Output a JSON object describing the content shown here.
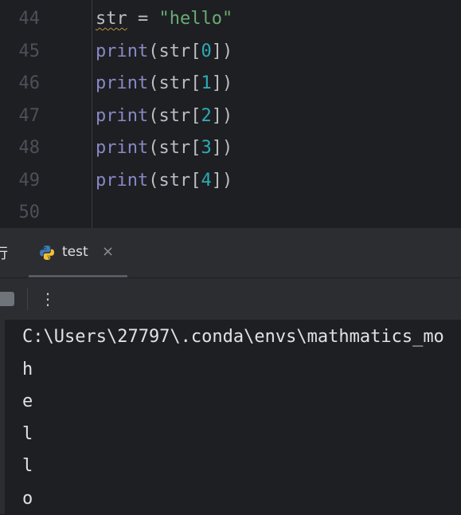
{
  "editor": {
    "lines": [
      {
        "num": "44",
        "parts": [
          {
            "t": "str",
            "c": "squiggle"
          },
          {
            "t": " = ",
            "c": ""
          },
          {
            "t": "\"hello\"",
            "c": "str"
          }
        ]
      },
      {
        "num": "45",
        "parts": [
          {
            "t": "print",
            "c": "kw"
          },
          {
            "t": "(str[",
            "c": ""
          },
          {
            "t": "0",
            "c": "num"
          },
          {
            "t": "])",
            "c": ""
          }
        ]
      },
      {
        "num": "46",
        "parts": [
          {
            "t": "print",
            "c": "kw"
          },
          {
            "t": "(str[",
            "c": ""
          },
          {
            "t": "1",
            "c": "num"
          },
          {
            "t": "])",
            "c": ""
          }
        ]
      },
      {
        "num": "47",
        "parts": [
          {
            "t": "print",
            "c": "kw"
          },
          {
            "t": "(str[",
            "c": ""
          },
          {
            "t": "2",
            "c": "num"
          },
          {
            "t": "])",
            "c": ""
          }
        ]
      },
      {
        "num": "48",
        "parts": [
          {
            "t": "print",
            "c": "kw"
          },
          {
            "t": "(str[",
            "c": ""
          },
          {
            "t": "3",
            "c": "num"
          },
          {
            "t": "])",
            "c": ""
          }
        ]
      },
      {
        "num": "49",
        "parts": [
          {
            "t": "print",
            "c": "kw"
          },
          {
            "t": "(str[",
            "c": ""
          },
          {
            "t": "4",
            "c": "num"
          },
          {
            "t": "])",
            "c": ""
          }
        ]
      },
      {
        "num": "50",
        "parts": []
      }
    ]
  },
  "run_panel": {
    "label": "行",
    "tab_label": "test",
    "tab_close": "×",
    "tab_icon": "python-icon",
    "more_icon": "⋮"
  },
  "console": {
    "lines": [
      "C:\\Users\\27797\\.conda\\envs\\mathmatics_mo",
      "h",
      "e",
      "l",
      "l",
      "o"
    ]
  },
  "colors": {
    "background": "#1e1f22",
    "panel": "#2b2d30",
    "keyword": "#8888c6",
    "string": "#6aab73",
    "number": "#2aacb8"
  }
}
